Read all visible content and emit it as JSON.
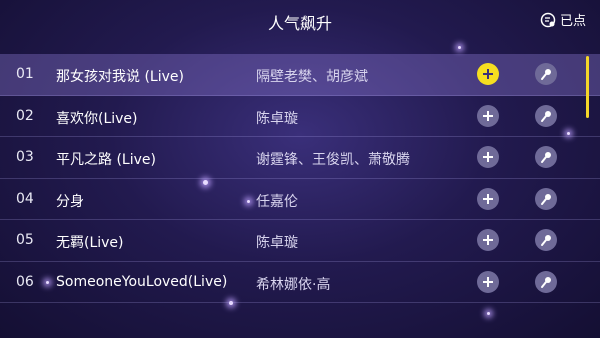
{
  "header": {
    "title": "人气飙升",
    "ordered_label": "已点"
  },
  "songs": [
    {
      "num": "01",
      "title": "那女孩对我说 (Live)",
      "artist": "隔壁老樊、胡彦斌",
      "highlighted": true
    },
    {
      "num": "02",
      "title": "喜欢你(Live)",
      "artist": "陈卓璇",
      "highlighted": false
    },
    {
      "num": "03",
      "title": "平凡之路 (Live)",
      "artist": "谢霆锋、王俊凯、萧敬腾",
      "highlighted": false
    },
    {
      "num": "04",
      "title": "分身",
      "artist": "任嘉伦",
      "highlighted": false
    },
    {
      "num": "05",
      "title": "无羁(Live)",
      "artist": "陈卓璇",
      "highlighted": false
    },
    {
      "num": "06",
      "title": "SomeoneYouLoved(Live)",
      "artist": "希林娜依·高",
      "highlighted": false
    }
  ],
  "icons": {
    "add": "plus-icon",
    "mic": "microphone-icon",
    "ordered": "ordered-list-icon"
  },
  "colors": {
    "accent": "#f6de20",
    "button": "#6f6a98",
    "background": "#221a4f"
  }
}
